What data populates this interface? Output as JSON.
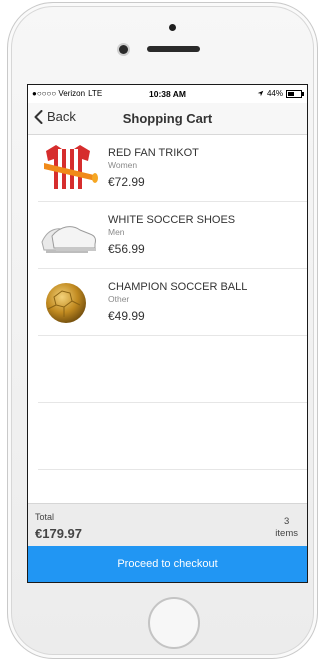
{
  "status_bar": {
    "carrier": "●○○○○ Verizon",
    "network": "LTE",
    "time": "10:38 AM",
    "battery": "44%"
  },
  "nav": {
    "back_label": "Back",
    "title": "Shopping Cart"
  },
  "cart_items": [
    {
      "name": "RED FAN TRIKOT",
      "category": "Women",
      "price": "€72.99",
      "image": "red-jersey-and-horn"
    },
    {
      "name": "WHITE SOCCER SHOES",
      "category": "Men",
      "price": "€56.99",
      "image": "white-soccer-shoes"
    },
    {
      "name": "CHAMPION SOCCER BALL",
      "category": "Other",
      "price": "€49.99",
      "image": "gold-soccer-ball"
    }
  ],
  "summary": {
    "total_label": "Total",
    "total_value": "€179.97",
    "items_count": "3",
    "items_label": "items"
  },
  "checkout": {
    "label": "Proceed to checkout"
  },
  "colors": {
    "accent": "#2196f3",
    "footer_bg": "#ececec",
    "nav_bg": "#f7f7f7"
  }
}
